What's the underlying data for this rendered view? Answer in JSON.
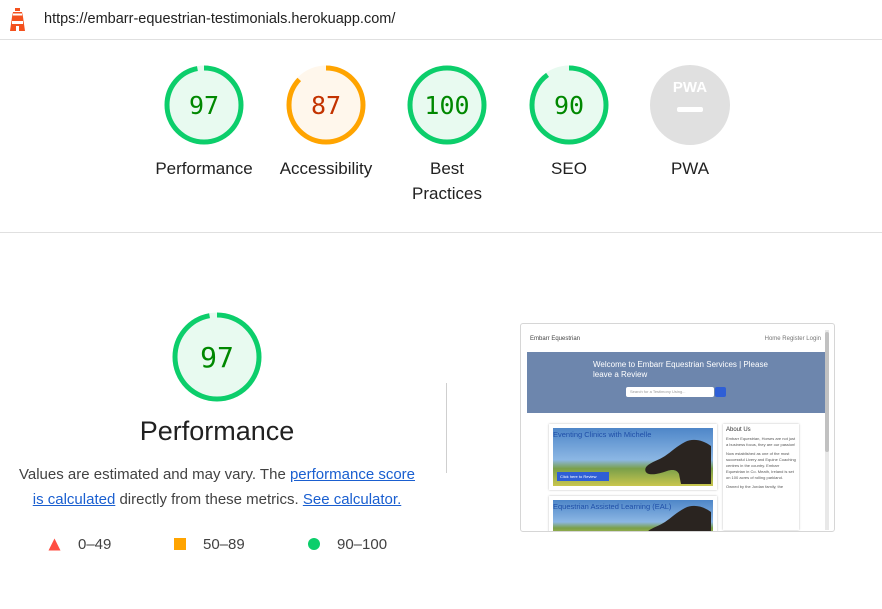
{
  "url_bar": {
    "url": "https://embarr-equestrian-testimonials.herokuapp.com/"
  },
  "gauges": [
    {
      "score": "97",
      "label": "Performance",
      "value": 97,
      "color": "#0cce6b",
      "fill": "#e8faf0",
      "text_color": "#008800"
    },
    {
      "score": "87",
      "label": "Accessibility",
      "value": 87,
      "color": "#ffa400",
      "fill": "#fff7ec",
      "text_color": "#c33300"
    },
    {
      "score": "100",
      "label": "Best Practices",
      "value": 100,
      "color": "#0cce6b",
      "fill": "#e8faf0",
      "text_color": "#008800"
    },
    {
      "score": "90",
      "label": "SEO",
      "value": 90,
      "color": "#0cce6b",
      "fill": "#e8faf0",
      "text_color": "#008800"
    },
    {
      "badge": "PWA",
      "label": "PWA",
      "color": "#e0e0e0"
    }
  ],
  "performance": {
    "score": "97",
    "title": "Performance",
    "desc_prefix": "Values are estimated and may vary. The ",
    "link_score": "performance score is calculated",
    "desc_middle": " directly from these metrics. ",
    "link_calculator": "See calculator.",
    "legend": [
      {
        "range": "0–49",
        "color": "#ff4e42"
      },
      {
        "range": "50–89",
        "color": "#ffa400"
      },
      {
        "range": "90–100",
        "color": "#0cce6b"
      }
    ]
  },
  "thumbnail": {
    "brand": "Embarr Equestrian",
    "nav_links": "Home   Register   Login",
    "hero_title": "Welcome to Embarr Equestrian Services | Please leave a Review",
    "search_placeholder": "Search for a Testimony Using...",
    "card1_title": "Eventing Clinics with Michelle",
    "card2_title": "Equestrian Assisted Learning (EAL)",
    "card_button": "Click here to Review",
    "about_title": "About Us",
    "about_text1": "Embarr Equestrian, Horses are not just a business focus, they are our passion!",
    "about_text2": "Now established as one of the most successful Livery and Equine Coaching centres in the country. Embarr Equestrian in Co. Meath, Ireland is set on 100 acres of rolling parkland.",
    "about_text3": "Owned by the Jordan family, the"
  }
}
